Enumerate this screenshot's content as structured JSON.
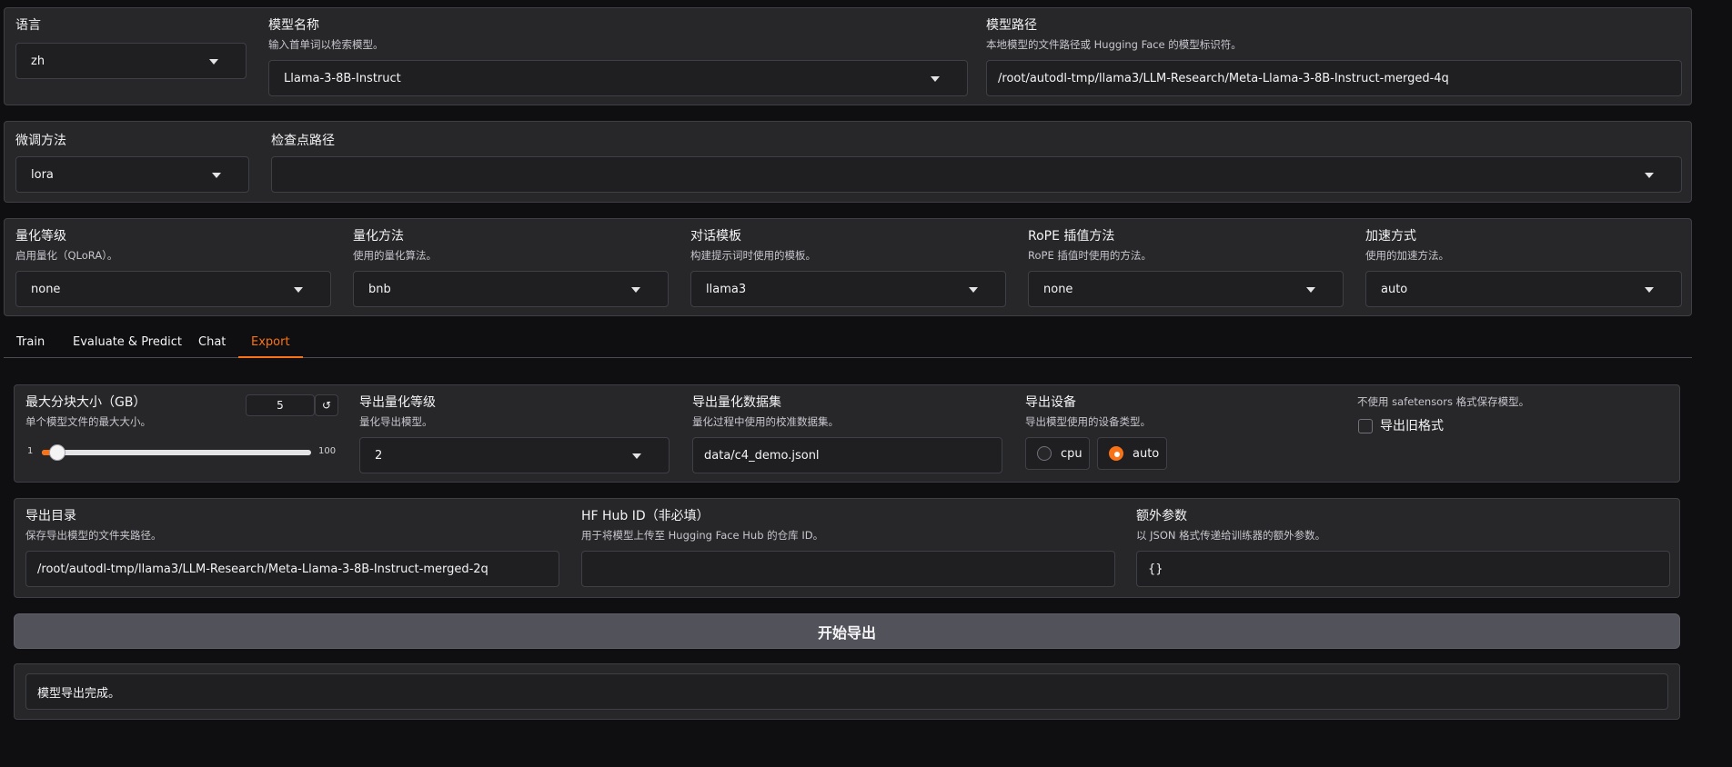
{
  "top": {
    "lang": {
      "label": "语言",
      "value": "zh"
    },
    "model_name": {
      "label": "模型名称",
      "info": "输入首单词以检索模型。",
      "value": "Llama-3-8B-Instruct"
    },
    "model_path": {
      "label": "模型路径",
      "info": "本地模型的文件路径或 Hugging Face 的模型标识符。",
      "value": "/root/autodl-tmp/llama3/LLM-Research/Meta-Llama-3-8B-Instruct-merged-4q"
    }
  },
  "finetune": {
    "method": {
      "label": "微调方法",
      "value": "lora"
    },
    "checkpoint": {
      "label": "检查点路径",
      "value": ""
    }
  },
  "advanced": {
    "quant_bit": {
      "label": "量化等级",
      "info": "启用量化（QLoRA）。",
      "value": "none"
    },
    "quant_method": {
      "label": "量化方法",
      "info": "使用的量化算法。",
      "value": "bnb"
    },
    "template": {
      "label": "对话模板",
      "info": "构建提示词时使用的模板。",
      "value": "llama3"
    },
    "rope": {
      "label": "RoPE 插值方法",
      "info": "RoPE 插值时使用的方法。",
      "value": "none"
    },
    "booster": {
      "label": "加速方式",
      "info": "使用的加速方法。",
      "value": "auto"
    }
  },
  "tabs": [
    "Train",
    "Evaluate & Predict",
    "Chat",
    "Export"
  ],
  "export": {
    "size": {
      "label": "最大分块大小（GB）",
      "info": "单个模型文件的最大大小。",
      "value": "5",
      "min": "1",
      "max": "100",
      "reset_icon": "↺"
    },
    "quant_bit": {
      "label": "导出量化等级",
      "info": "量化导出模型。",
      "value": "2"
    },
    "quant_dataset": {
      "label": "导出量化数据集",
      "info": "量化过程中使用的校准数据集。",
      "value": "data/c4_demo.jsonl"
    },
    "device": {
      "label": "导出设备",
      "info": "导出模型使用的设备类型。",
      "options": [
        "cpu",
        "auto"
      ],
      "selected": "auto"
    },
    "legacy": {
      "info": "不使用 safetensors 格式保存模型。",
      "label": "导出旧格式"
    },
    "dir": {
      "label": "导出目录",
      "info": "保存导出模型的文件夹路径。",
      "value": "/root/autodl-tmp/llama3/LLM-Research/Meta-Llama-3-8B-Instruct-merged-2q"
    },
    "hub": {
      "label": "HF Hub ID（非必填）",
      "info": "用于将模型上传至 Hugging Face Hub 的仓库 ID。",
      "value": ""
    },
    "extra": {
      "label": "额外参数",
      "info": "以 JSON 格式传递给训练器的额外参数。",
      "value": "{}"
    },
    "button": "开始导出",
    "output": "模型导出完成。"
  },
  "colors": {
    "accent": "#f97316",
    "panel": "#27272a",
    "input": "#1f1f22"
  }
}
